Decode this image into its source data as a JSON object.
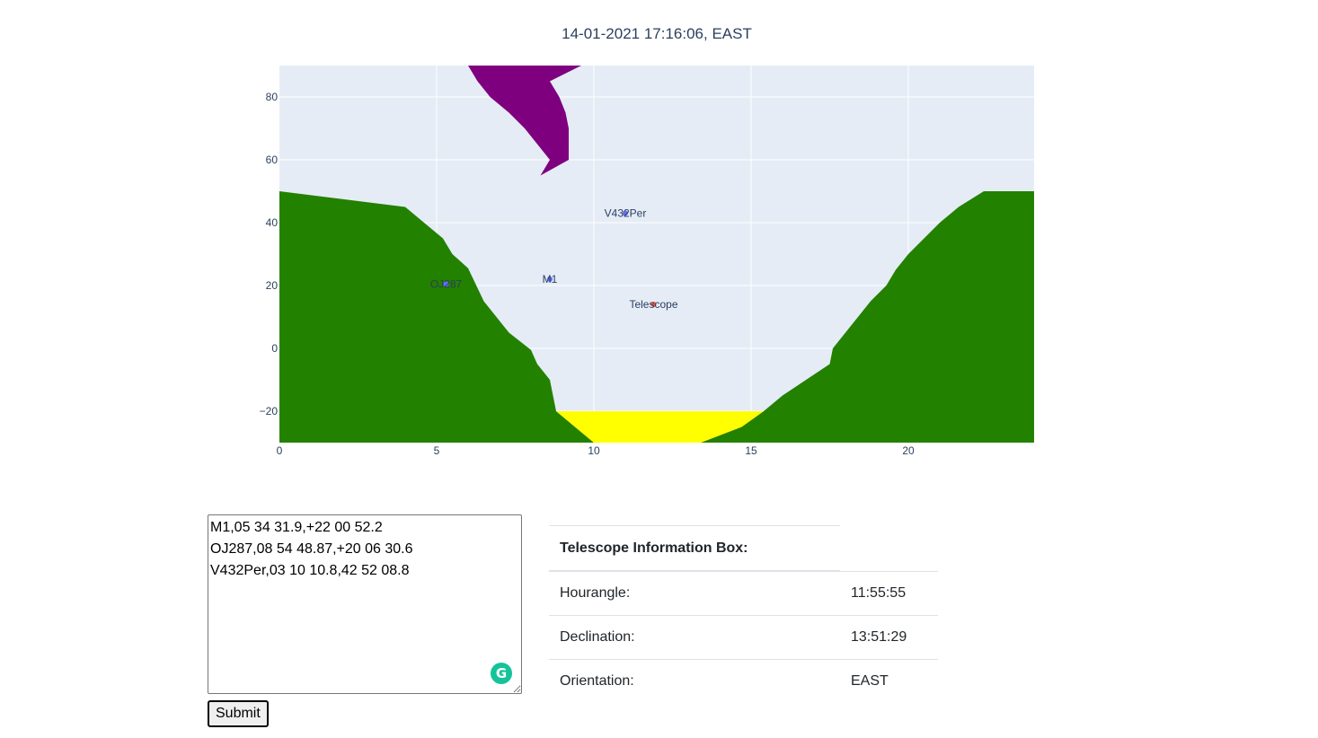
{
  "plot": {
    "title": "14-01-2021 17:16:06, EAST"
  },
  "chart_data": {
    "type": "scatter",
    "xlim": [
      0,
      24
    ],
    "ylim": [
      -30,
      90
    ],
    "x_ticks": [
      0,
      5,
      10,
      15,
      20
    ],
    "y_ticks": [
      -20,
      0,
      20,
      40,
      60,
      80
    ],
    "y_tick_labels": [
      "−20",
      "0",
      "20",
      "40",
      "60",
      "80"
    ],
    "grid": true,
    "background_color": "#e5ecf6",
    "points": [
      {
        "name": "M1",
        "x": 8.6,
        "y": 22,
        "color": "#636efa"
      },
      {
        "name": "OJ287",
        "x": 5.3,
        "y": 20.5,
        "color": "#636efa"
      },
      {
        "name": "V432Per",
        "x": 11.0,
        "y": 43,
        "color": "#636efa"
      },
      {
        "name": "Telescope",
        "x": 11.9,
        "y": 14,
        "color": "#ef553b"
      }
    ],
    "regions": [
      {
        "name": "left-horizon",
        "color": "#238100",
        "polygon": [
          [
            0,
            50
          ],
          [
            4,
            45
          ],
          [
            5.2,
            35
          ],
          [
            5.5,
            30
          ],
          [
            6,
            25.5
          ],
          [
            6.5,
            15
          ],
          [
            7.3,
            5
          ],
          [
            8,
            -0.5
          ],
          [
            8.2,
            -5
          ],
          [
            8.6,
            -10
          ],
          [
            8.8,
            -20
          ],
          [
            10,
            -30
          ],
          [
            0,
            -30
          ]
        ]
      },
      {
        "name": "right-horizon",
        "color": "#238100",
        "polygon": [
          [
            24,
            50
          ],
          [
            22.4,
            50
          ],
          [
            21.6,
            45
          ],
          [
            21,
            40
          ],
          [
            20,
            30
          ],
          [
            19.6,
            25
          ],
          [
            19.3,
            20
          ],
          [
            18.8,
            15
          ],
          [
            17.6,
            0
          ],
          [
            17.5,
            -5
          ],
          [
            16,
            -15
          ],
          [
            15.4,
            -20
          ],
          [
            14.7,
            -25
          ],
          [
            13.4,
            -30
          ],
          [
            24,
            -30
          ]
        ]
      },
      {
        "name": "yellow-zone",
        "color": "#ffff00",
        "polygon": [
          [
            8.8,
            -20
          ],
          [
            15.4,
            -20
          ],
          [
            14.7,
            -25
          ],
          [
            13.4,
            -30
          ],
          [
            10,
            -30
          ]
        ]
      },
      {
        "name": "purple-zone",
        "color": "#7f007f",
        "polygon": [
          [
            6,
            90
          ],
          [
            9.6,
            90
          ],
          [
            8.6,
            85
          ],
          [
            8.9,
            80
          ],
          [
            9.1,
            75
          ],
          [
            9.2,
            70
          ],
          [
            9.2,
            60
          ],
          [
            8.3,
            55
          ],
          [
            8.6,
            60
          ],
          [
            8.2,
            65
          ],
          [
            7.8,
            70
          ],
          [
            7.3,
            75
          ],
          [
            6.7,
            80
          ],
          [
            6.3,
            85
          ]
        ]
      }
    ]
  },
  "form": {
    "textarea_value": "M1,05 34 31.9,+22 00 52.2\nOJ287,08 54 48.87,+20 06 30.6\nV432Per,03 10 10.8,42 52 08.8",
    "submit_label": "Submit",
    "grammarly_glyph": "G"
  },
  "info_box": {
    "header": "Telescope Information Box:",
    "rows": [
      {
        "label": "Hourangle:",
        "value": "11:55:55"
      },
      {
        "label": "Declination:",
        "value": "13:51:29"
      },
      {
        "label": "Orientation:",
        "value": "EAST"
      }
    ]
  }
}
